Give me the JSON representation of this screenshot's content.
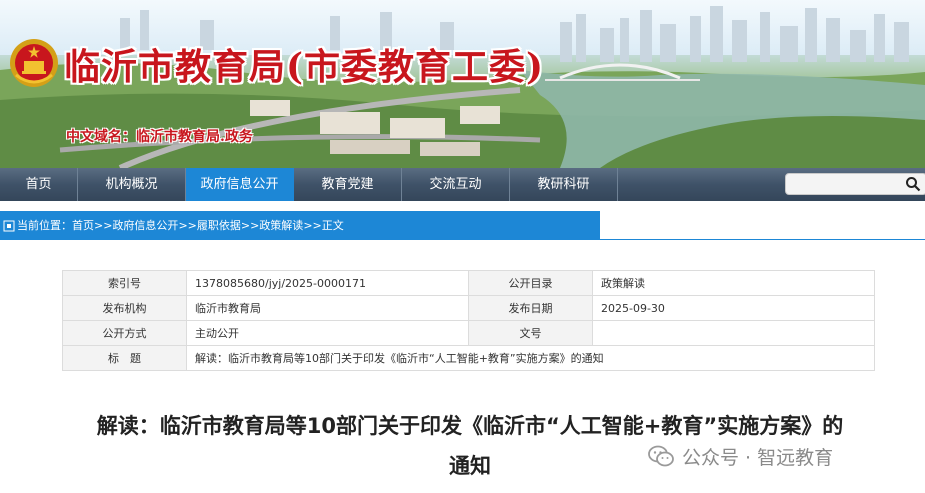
{
  "header": {
    "site_title": "临沂市教育局(市委教育工委)",
    "domain_label": "中文域名：临沂市教育局.政务"
  },
  "nav": {
    "items": [
      "首页",
      "机构概况",
      "政府信息公开",
      "教育党建",
      "交流互动",
      "教研科研"
    ],
    "active_index": 2,
    "search_placeholder": ""
  },
  "breadcrumb": {
    "prefix": "当前位置：",
    "items": [
      "首页",
      "政府信息公开",
      "履职依据",
      "政策解读",
      "正文"
    ],
    "separator": ">>"
  },
  "meta": {
    "rows": [
      {
        "k1": "索引号",
        "v1": "1378085680/jyj/2025-0000171",
        "k2": "公开目录",
        "v2": "政策解读"
      },
      {
        "k1": "发布机构",
        "v1": "临沂市教育局",
        "k2": "发布日期",
        "v2": "2025-09-30"
      },
      {
        "k1": "公开方式",
        "v1": "主动公开",
        "k2": "文号",
        "v2": ""
      }
    ],
    "title_key": "标　题",
    "title_value": "解读：临沂市教育局等10部门关于印发《临沂市“人工智能+教育”实施方案》的通知"
  },
  "article": {
    "title_line1": "解读：临沂市教育局等10部门关于印发《临沂市“人工智能+教育”实施方案》的",
    "title_line2": "通知"
  },
  "watermark": {
    "text": "公众号 · 智远教育"
  },
  "colors": {
    "brand_red": "#c8161d",
    "nav_active": "#1d87d6",
    "nav_bg": "#3f5268"
  }
}
